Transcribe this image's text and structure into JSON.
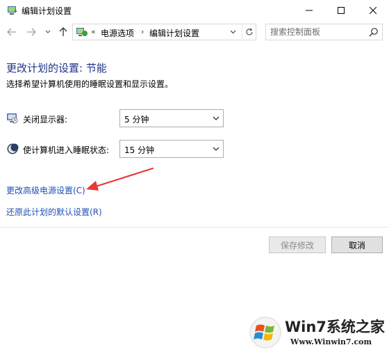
{
  "window": {
    "title": "编辑计划设置",
    "controls": [
      "minimize",
      "maximize",
      "close"
    ]
  },
  "nav": {
    "back_icon": "back-arrow-icon",
    "forward_icon": "forward-arrow-icon",
    "up_icon": "up-arrow-icon",
    "breadcrumb_prefix": "«",
    "breadcrumbs": [
      "电源选项",
      "编辑计划设置"
    ],
    "breadcrumb_separator": "›",
    "search_placeholder": "搜索控制面板"
  },
  "content": {
    "heading": "更改计划的设置: 节能",
    "description": "选择希望计算机使用的睡眠设置和显示设置。",
    "settings": [
      {
        "label": "关闭显示器:",
        "value": "5 分钟",
        "icon": "monitor-icon"
      },
      {
        "label": "使计算机进入睡眠状态:",
        "value": "15 分钟",
        "icon": "moon-sleep-icon"
      }
    ],
    "links": [
      "更改高级电源设置(C)",
      "还原此计划的默认设置(R)"
    ]
  },
  "buttons": {
    "save": "保存修改",
    "cancel": "取消"
  },
  "watermark": {
    "title": "Win7系统之家",
    "url": "Www.Winwin7.com"
  },
  "colors": {
    "heading": "#1e3287",
    "link": "#1e4fb4",
    "annotation_arrow": "#e53935"
  }
}
